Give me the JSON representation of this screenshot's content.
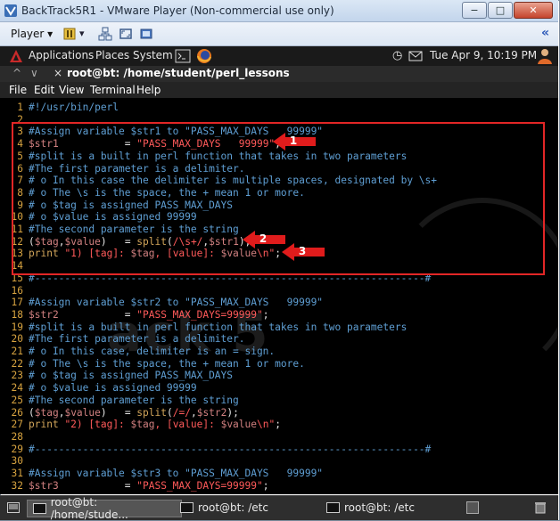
{
  "window": {
    "title": "BackTrack5R1 - VMware Player (Non-commercial use only)",
    "minimize": "−",
    "maximize": "□",
    "close": "✕"
  },
  "vmware_toolbar": {
    "player_menu": "Player ▾",
    "pause_arrow": "▾",
    "collapse": "«"
  },
  "gnome_panel": {
    "applications": "Applications",
    "places": "Places",
    "system": "System",
    "clock": "Tue Apr  9, 10:19 PM"
  },
  "terminal": {
    "title": "root@bt: /home/student/perl_lessons",
    "menu": [
      "File",
      "Edit",
      "View",
      "Terminal",
      "Help"
    ]
  },
  "watermark": "ack 5",
  "code_lines": [
    {
      "n": "1",
      "parts": [
        [
          "c-com",
          "#!/usr/bin/perl"
        ]
      ]
    },
    {
      "n": "2",
      "parts": []
    },
    {
      "n": "3",
      "parts": [
        [
          "c-com",
          "#Assign variable $str1 to \"PASS_MAX_DAYS   99999\""
        ]
      ]
    },
    {
      "n": "4",
      "parts": [
        [
          "c-var",
          "$str1"
        ],
        [
          "c-plain",
          "           = "
        ],
        [
          "c-str",
          "\"PASS_MAX_DAYS   99999\""
        ],
        [
          "c-plain",
          ";"
        ]
      ]
    },
    {
      "n": "5",
      "parts": [
        [
          "c-com",
          "#split is a built in perl function that takes in two parameters"
        ]
      ]
    },
    {
      "n": "6",
      "parts": [
        [
          "c-com",
          "#The first parameter is a delimiter."
        ]
      ]
    },
    {
      "n": "7",
      "parts": [
        [
          "c-com",
          "# o In this case the delimiter is multiple spaces, designated by \\s+"
        ]
      ]
    },
    {
      "n": "8",
      "parts": [
        [
          "c-com",
          "# o The \\s is the space, the + mean 1 or more."
        ]
      ]
    },
    {
      "n": "9",
      "parts": [
        [
          "c-com",
          "# o $tag is assigned PASS_MAX_DAYS"
        ]
      ]
    },
    {
      "n": "10",
      "parts": [
        [
          "c-com",
          "# o $value is assigned 99999"
        ]
      ]
    },
    {
      "n": "11",
      "parts": [
        [
          "c-com",
          "#The second parameter is the string"
        ]
      ]
    },
    {
      "n": "12",
      "parts": [
        [
          "c-plain",
          "("
        ],
        [
          "c-var",
          "$tag"
        ],
        [
          "c-plain",
          ","
        ],
        [
          "c-var",
          "$value"
        ],
        [
          "c-plain",
          ")   = "
        ],
        [
          "c-kw",
          "split"
        ],
        [
          "c-plain",
          "("
        ],
        [
          "c-str",
          "/\\s+/"
        ],
        [
          "c-plain",
          ","
        ],
        [
          "c-var",
          "$str1"
        ],
        [
          "c-plain",
          ");"
        ]
      ]
    },
    {
      "n": "13",
      "parts": [
        [
          "c-kw",
          "print"
        ],
        [
          "c-plain",
          " "
        ],
        [
          "c-str",
          "\"1) [tag]: "
        ],
        [
          "c-var",
          "$tag"
        ],
        [
          "c-str",
          ", [value]: "
        ],
        [
          "c-var",
          "$value"
        ],
        [
          "c-str",
          "\\n\""
        ],
        [
          "c-plain",
          ";"
        ]
      ]
    },
    {
      "n": "14",
      "parts": []
    },
    {
      "n": "15",
      "parts": [
        [
          "c-com",
          "#-----------------------------------------------------------------#"
        ]
      ]
    },
    {
      "n": "16",
      "parts": []
    },
    {
      "n": "17",
      "parts": [
        [
          "c-com",
          "#Assign variable $str2 to \"PASS_MAX_DAYS   99999\""
        ]
      ]
    },
    {
      "n": "18",
      "parts": [
        [
          "c-var",
          "$str2"
        ],
        [
          "c-plain",
          "           = "
        ],
        [
          "c-str",
          "\"PASS_MAX_DAYS=99999\""
        ],
        [
          "c-plain",
          ";"
        ]
      ]
    },
    {
      "n": "19",
      "parts": [
        [
          "c-com",
          "#split is a built in perl function that takes in two parameters"
        ]
      ]
    },
    {
      "n": "20",
      "parts": [
        [
          "c-com",
          "#The first parameter is a delimiter."
        ]
      ]
    },
    {
      "n": "21",
      "parts": [
        [
          "c-com",
          "# o In this case, delimiter is an = sign."
        ]
      ]
    },
    {
      "n": "22",
      "parts": [
        [
          "c-com",
          "# o The \\s is the space, the + mean 1 or more."
        ]
      ]
    },
    {
      "n": "23",
      "parts": [
        [
          "c-com",
          "# o $tag is assigned PASS_MAX_DAYS"
        ]
      ]
    },
    {
      "n": "24",
      "parts": [
        [
          "c-com",
          "# o $value is assigned 99999"
        ]
      ]
    },
    {
      "n": "25",
      "parts": [
        [
          "c-com",
          "#The second parameter is the string"
        ]
      ]
    },
    {
      "n": "26",
      "parts": [
        [
          "c-plain",
          "("
        ],
        [
          "c-var",
          "$tag"
        ],
        [
          "c-plain",
          ","
        ],
        [
          "c-var",
          "$value"
        ],
        [
          "c-plain",
          ")   = "
        ],
        [
          "c-kw",
          "split"
        ],
        [
          "c-plain",
          "("
        ],
        [
          "c-str",
          "/=/"
        ],
        [
          "c-plain",
          ","
        ],
        [
          "c-var",
          "$str2"
        ],
        [
          "c-plain",
          ");"
        ]
      ]
    },
    {
      "n": "27",
      "parts": [
        [
          "c-kw",
          "print"
        ],
        [
          "c-plain",
          " "
        ],
        [
          "c-str",
          "\"2) [tag]: "
        ],
        [
          "c-var",
          "$tag"
        ],
        [
          "c-str",
          ", [value]: "
        ],
        [
          "c-var",
          "$value"
        ],
        [
          "c-str",
          "\\n\""
        ],
        [
          "c-plain",
          ";"
        ]
      ]
    },
    {
      "n": "28",
      "parts": []
    },
    {
      "n": "29",
      "parts": [
        [
          "c-com",
          "#-----------------------------------------------------------------#"
        ]
      ]
    },
    {
      "n": "30",
      "parts": []
    },
    {
      "n": "31",
      "parts": [
        [
          "c-com",
          "#Assign variable $str3 to \"PASS_MAX_DAYS   99999\""
        ]
      ]
    },
    {
      "n": "32",
      "parts": [
        [
          "c-var",
          "$str3"
        ],
        [
          "c-plain",
          "           = "
        ],
        [
          "c-str",
          "\"PASS_MAX_DAYS=99999\""
        ],
        [
          "c-plain",
          ";"
        ]
      ]
    }
  ],
  "callouts": [
    "1",
    "2",
    "3"
  ],
  "taskbar": {
    "items": [
      "root@bt: /home/stude...",
      "root@bt: /etc",
      "root@bt: /etc"
    ]
  }
}
